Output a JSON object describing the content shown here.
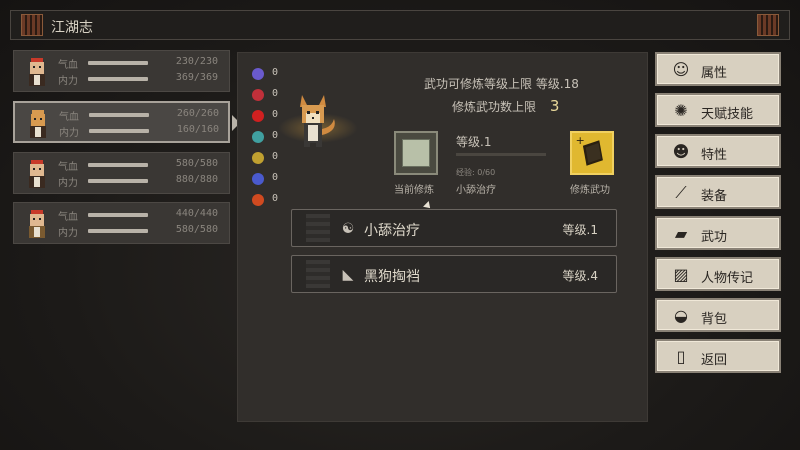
{
  "window": {
    "title": "江湖志"
  },
  "characters": [
    {
      "hp_label": "气血",
      "mp_label": "内力",
      "hp": "230/230",
      "mp": "369/369",
      "hp_frac": 1.0,
      "mp_frac": 1.0,
      "selected": false
    },
    {
      "hp_label": "气血",
      "mp_label": "内力",
      "hp": "260/260",
      "mp": "160/160",
      "hp_frac": 1.0,
      "mp_frac": 1.0,
      "selected": true
    },
    {
      "hp_label": "气血",
      "mp_label": "内力",
      "hp": "580/580",
      "mp": "880/880",
      "hp_frac": 1.0,
      "mp_frac": 1.0,
      "selected": false
    },
    {
      "hp_label": "气血",
      "mp_label": "内力",
      "hp": "440/440",
      "mp": "580/580",
      "hp_frac": 1.0,
      "mp_frac": 1.0,
      "selected": false
    }
  ],
  "stats": [
    {
      "icon": "purple-skull-icon",
      "color": "#6a5acd",
      "value": "0"
    },
    {
      "icon": "broken-heart-icon",
      "color": "#c0303a",
      "value": "0"
    },
    {
      "icon": "red-orb-icon",
      "color": "#d02020",
      "value": "0"
    },
    {
      "icon": "teal-skull-icon",
      "color": "#40a0a0",
      "value": "0"
    },
    {
      "icon": "gold-bug-icon",
      "color": "#c0a030",
      "value": "0"
    },
    {
      "icon": "blue-ring-icon",
      "color": "#4a5acd",
      "value": "0"
    },
    {
      "icon": "fire-icon",
      "color": "#d04a20",
      "value": "0"
    }
  ],
  "martial": {
    "max_level_text": "武功可修炼等级上限 等级.18",
    "max_count_label": "修炼武功数上限",
    "max_count_value": "3",
    "current_level": "等级.1",
    "exp_text": "经验: 0/60",
    "current_label": "当前修炼",
    "current_name": "小舔治疗",
    "train_label": "修炼武功"
  },
  "skills": [
    {
      "icon": "yin-yang-icon",
      "name": "小舔治疗",
      "level": "等级.1"
    },
    {
      "icon": "fan-icon",
      "name": "黑狗掏裆",
      "level": "等级.4"
    }
  ],
  "menu": [
    {
      "icon": "person-icon",
      "label": "属性"
    },
    {
      "icon": "talent-icon",
      "label": "天赋技能"
    },
    {
      "icon": "trait-icon",
      "label": "特性"
    },
    {
      "icon": "sword-icon",
      "label": "装备"
    },
    {
      "icon": "book-icon",
      "label": "武功"
    },
    {
      "icon": "scroll-icon",
      "label": "人物传记"
    },
    {
      "icon": "bag-icon",
      "label": "背包"
    },
    {
      "icon": "door-icon",
      "label": "返回"
    }
  ],
  "colors": {
    "accent_gold": "#e0b830",
    "panel": "#312e2b",
    "menu_bg": "#d8d0c0"
  }
}
